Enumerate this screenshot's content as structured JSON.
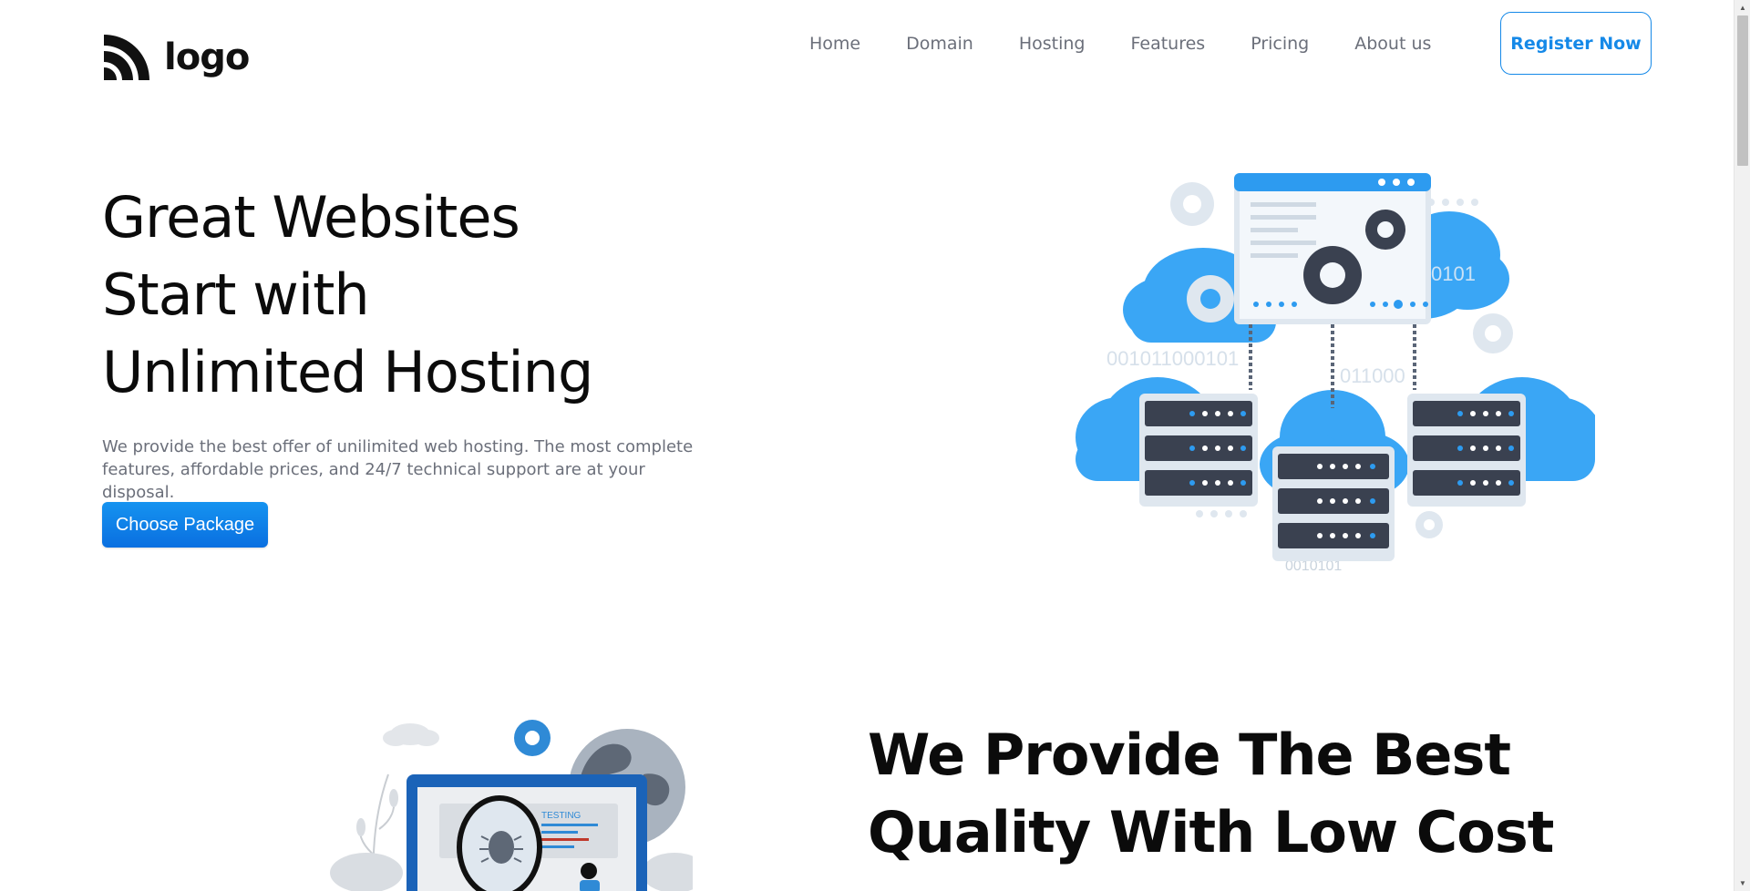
{
  "header": {
    "logo_text": "logo",
    "nav": [
      "Home",
      "Domain",
      "Hosting",
      "Features",
      "Pricing",
      "About us"
    ],
    "register_label": "Register Now"
  },
  "hero": {
    "title_lines": [
      "Great Websites",
      "Start with",
      "Unlimited Hosting"
    ],
    "description": "We provide the best offer of unilimited web hosting. The most complete features, affordable prices, and 24/7 technical support are at your disposal.",
    "cta_label": "Choose Package",
    "illustration": {
      "binary_1": "0101",
      "binary_2": "001011000101",
      "binary_3": "011000",
      "binary_4": "0010101"
    }
  },
  "section2": {
    "title_lines": [
      "We Provide The Best",
      "Quality With Low Cost"
    ],
    "illustration": {
      "testing_label": "TESTING"
    }
  },
  "colors": {
    "accent": "#1589e8",
    "cloud": "#3aa6f5",
    "server_dark": "#3a4150",
    "text_muted": "#6b6f7a"
  }
}
